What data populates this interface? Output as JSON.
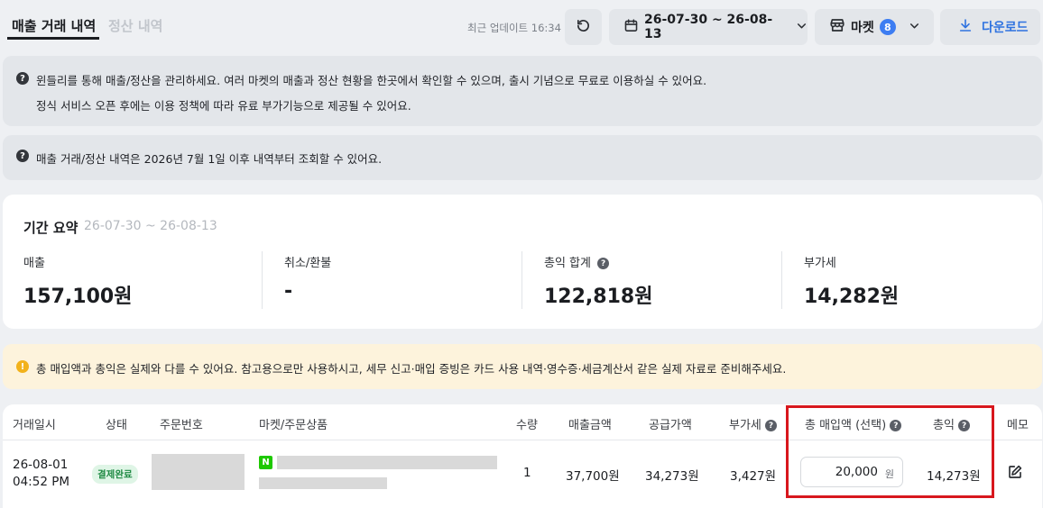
{
  "tabs": {
    "active": "매출 거래 내역",
    "inactive": "정산 내역"
  },
  "header": {
    "last_update": "최근 업데이트 16:34",
    "date_range": "26-07-30 ~ 26-08-13",
    "market_label": "마켓",
    "market_count": "8",
    "download_label": "다운로드"
  },
  "info1": {
    "line1": "윈들리를 통해 매출/정산을 관리하세요. 여러 마켓의 매출과 정산 현황을 한곳에서 확인할 수 있으며, 출시 기념으로 무료로 이용하실 수 있어요.",
    "line2": "정식 서비스 오픈 후에는 이용 정책에 따라 유료 부가기능으로 제공될 수 있어요."
  },
  "info2": {
    "line1": "매출 거래/정산 내역은 2026년 7월 1일 이후 내역부터 조회할 수 있어요."
  },
  "summary": {
    "title": "기간 요약",
    "range": "26-07-30 ~ 26-08-13",
    "items": [
      {
        "label": "매출",
        "value": "157,100원"
      },
      {
        "label": "취소/환불",
        "value": "-"
      },
      {
        "label": "총익 합계",
        "value": "122,818원"
      },
      {
        "label": "부가세",
        "value": "14,282원"
      }
    ]
  },
  "warning": "총 매입액과 총익은 실제와 다를 수 있어요. 참고용으로만 사용하시고, 세무 신고·매입 증빙은 카드 사용 내역·영수증·세금계산서 같은 실제 자료로 준비해주세요.",
  "table": {
    "headers": {
      "date": "거래일시",
      "status": "상태",
      "order_no": "주문번호",
      "market_product": "마켓/주문상품",
      "qty": "수량",
      "sales": "매출금액",
      "supply": "공급가액",
      "vat": "부가세",
      "purchase": "총 매입액 (선택)",
      "profit": "총익",
      "memo": "메모"
    },
    "rows": [
      {
        "date": "26-08-01",
        "time": "04:52 PM",
        "status": "결제완료",
        "market_icon": "N",
        "qty": "1",
        "sales": "37,700원",
        "supply": "34,273원",
        "vat": "3,427원",
        "purchase_value": "20,000",
        "purchase_unit": "원",
        "profit": "14,273원"
      }
    ]
  },
  "icons": {
    "refresh": "refresh-icon",
    "calendar": "calendar-icon",
    "store": "store-icon",
    "download": "download-icon",
    "help": "question-icon",
    "warning": "warning-icon",
    "edit": "edit-icon"
  },
  "colors": {
    "accent": "#2f73e0",
    "badge": "#3d7df2",
    "status_bg": "#dff5e6",
    "status_text": "#1f8a43",
    "warning_bg": "#fdf3dc",
    "highlight": "#d8171d"
  }
}
